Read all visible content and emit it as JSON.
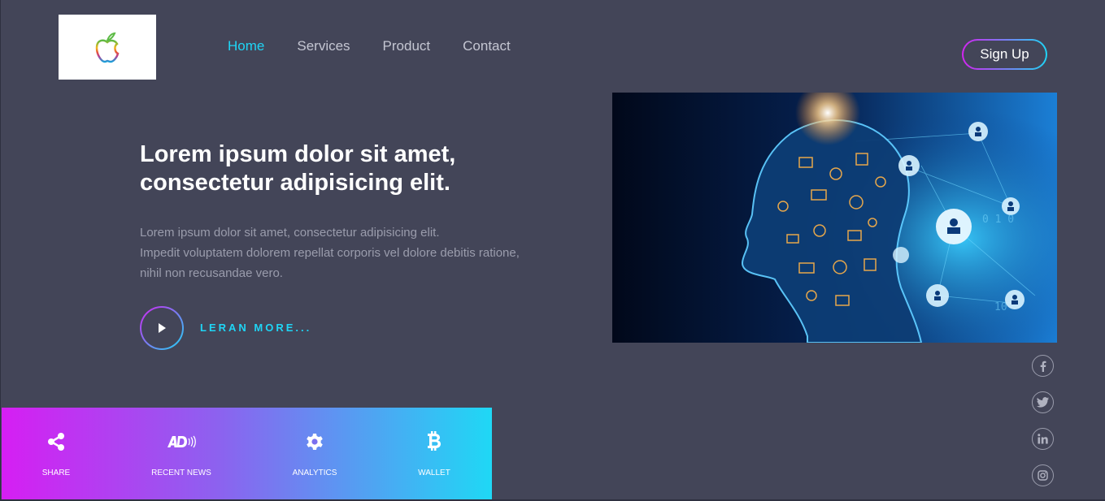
{
  "logo": {
    "icon": "apple-logo-icon"
  },
  "nav": {
    "items": [
      {
        "label": "Home",
        "active": true
      },
      {
        "label": "Services",
        "active": false
      },
      {
        "label": "Product",
        "active": false
      },
      {
        "label": "Contact",
        "active": false
      }
    ]
  },
  "header": {
    "signup_label": "Sign Up"
  },
  "hero": {
    "title_line1": "Lorem ipsum dolor sit amet,",
    "title_line2": "consectetur adipisicing elit.",
    "text_line1": "Lorem ipsum dolor sit amet, consectetur adipisicing elit.",
    "text_line2": "Impedit voluptatem dolorem repellat corporis vel dolore debitis ratione,",
    "text_line3": "nihil non recusandae vero.",
    "learn_more": "LERAN MORE..."
  },
  "social": [
    "facebook-icon",
    "twitter-icon",
    "linkedin-icon",
    "instagram-icon"
  ],
  "features": [
    {
      "label": "SHARE",
      "icon": "share-icon"
    },
    {
      "label": "RECENT NEWS",
      "icon": "audio-description-icon"
    },
    {
      "label": "ANALYTICS",
      "icon": "gear-icon"
    },
    {
      "label": "WALLET",
      "icon": "bitcoin-icon"
    }
  ],
  "colors": {
    "background": "#434558",
    "accent": "#1fd5f5",
    "gradient_start": "#d324f0",
    "gradient_end": "#1fd5f5"
  }
}
